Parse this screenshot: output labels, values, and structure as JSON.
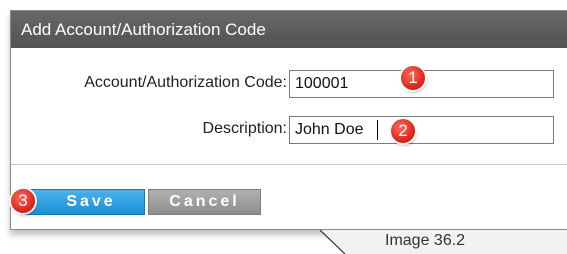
{
  "dialog": {
    "title": "Add Account/Authorization Code",
    "fields": {
      "code": {
        "label": "Account/Authorization Code:",
        "value": "100001"
      },
      "description": {
        "label": "Description:",
        "value": "John Doe"
      }
    },
    "buttons": {
      "save_label": "Save",
      "cancel_label": "Cancel"
    }
  },
  "markers": [
    "1",
    "2",
    "3"
  ],
  "caption": "Image 36.2",
  "colors": {
    "titlebar": "#5c5c5c",
    "save_button": "#2a9ee0",
    "cancel_button": "#9e9e9e",
    "marker": "#e0342a"
  }
}
